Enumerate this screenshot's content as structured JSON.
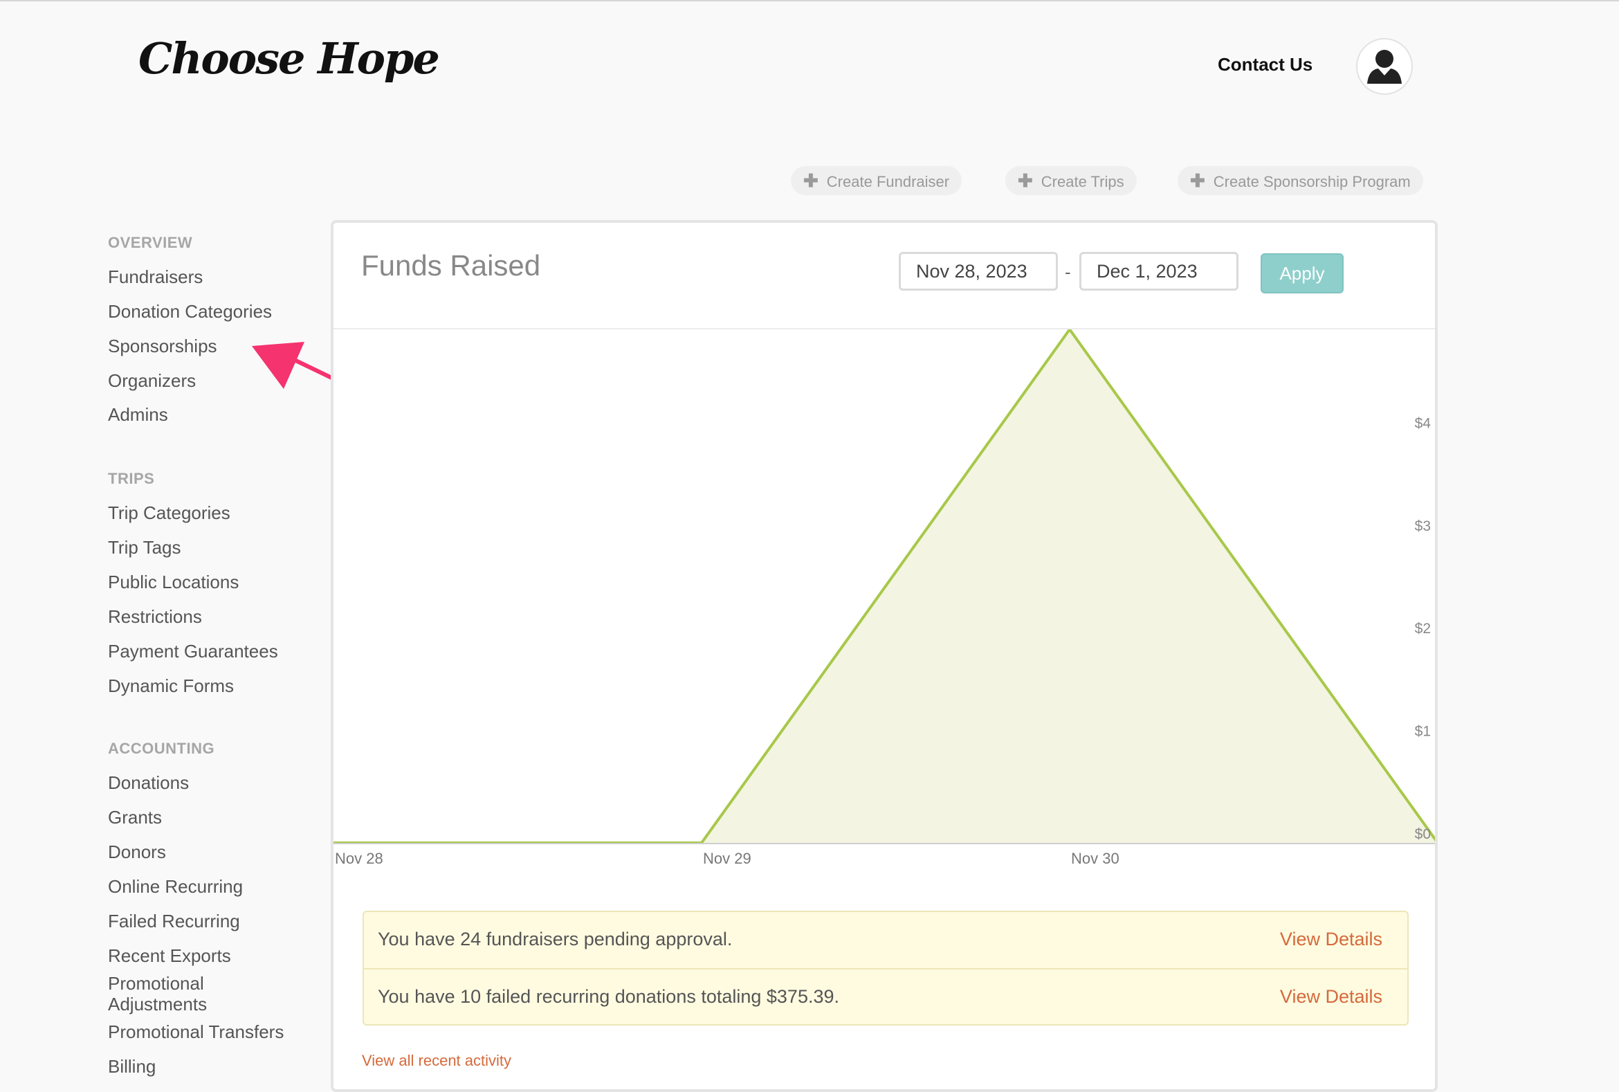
{
  "header": {
    "logo_text": "Choose Hope",
    "contact_label": "Contact Us",
    "avatar_icon": "user-avatar-icon"
  },
  "actions": [
    {
      "label": "Create Fundraiser",
      "icon": "plus-icon"
    },
    {
      "label": "Create Trips",
      "icon": "plus-icon"
    },
    {
      "label": "Create Sponsorship Program",
      "icon": "plus-icon"
    }
  ],
  "sidebar": {
    "sections": [
      {
        "heading": "OVERVIEW",
        "items": [
          "Fundraisers",
          "Donation Categories",
          "Sponsorships",
          "Organizers",
          "Admins"
        ]
      },
      {
        "heading": "TRIPS",
        "items": [
          "Trip Categories",
          "Trip Tags",
          "Public Locations",
          "Restrictions",
          "Payment Guarantees",
          "Dynamic Forms"
        ]
      },
      {
        "heading": "ACCOUNTING",
        "items": [
          "Donations",
          "Grants",
          "Donors",
          "Online Recurring",
          "Failed Recurring",
          "Recent Exports",
          "Promotional Adjustments",
          "Promotional Transfers",
          "Billing"
        ]
      }
    ]
  },
  "panel": {
    "title": "Funds Raised",
    "start_date": "Nov 28, 2023",
    "end_date": "Dec 1, 2023",
    "date_separator": "-",
    "apply_label": "Apply"
  },
  "chart_data": {
    "type": "area",
    "x": [
      "Nov 28",
      "Nov 29",
      "Nov 30",
      "Dec 1"
    ],
    "values": [
      0,
      0,
      5,
      0
    ],
    "x_tick_labels": [
      "Nov 28",
      "Nov 29",
      "Nov 30"
    ],
    "y_tick_labels": [
      "$0",
      "$1",
      "$2",
      "$3",
      "$4"
    ],
    "ylim": [
      0,
      5
    ],
    "line_color": "#a8c84a",
    "fill_color": "#f3f4e1",
    "y_axis_side": "right",
    "grid": false
  },
  "notices": [
    {
      "text": "You have 24 fundraisers pending approval.",
      "link": "View Details"
    },
    {
      "text": "You have 10 failed recurring donations totaling $375.39.",
      "link": "View Details"
    }
  ],
  "recent_activity_label": "View all recent activity",
  "colors": {
    "accent_link": "#d46a3c",
    "apply_button": "#8ecfcb",
    "notice_bg": "#fefbe0",
    "annotation_arrow": "#f5336e"
  }
}
